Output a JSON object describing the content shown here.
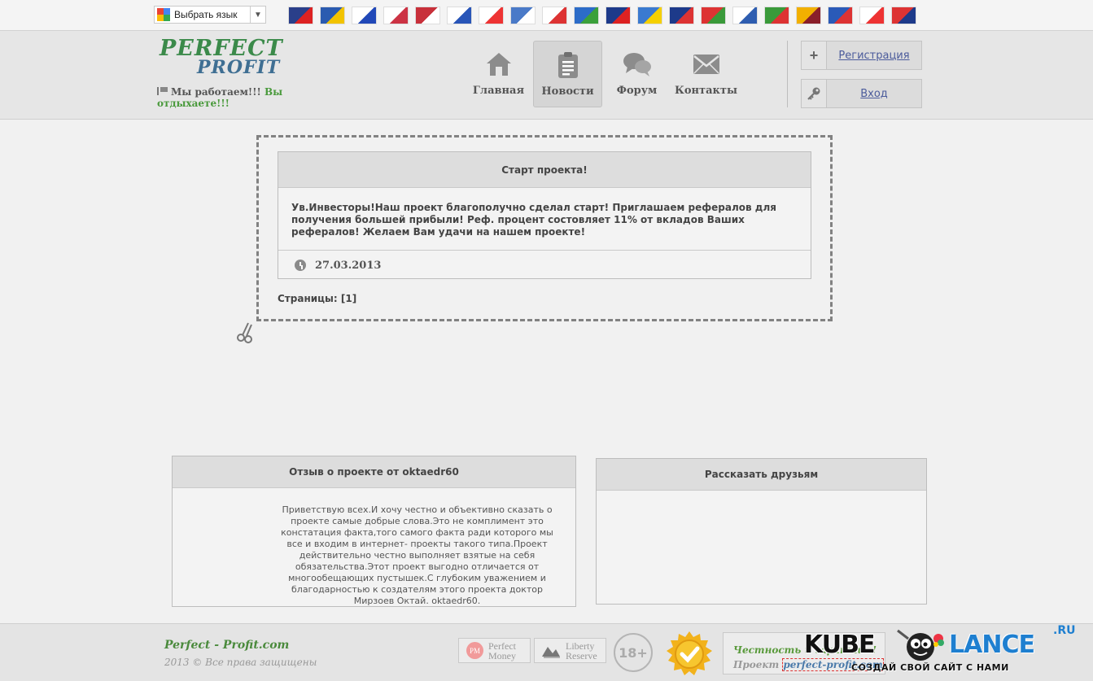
{
  "translate": {
    "label": "Выбрать язык",
    "arrow": "▼"
  },
  "flags": [
    {
      "name": "uk",
      "c1": "#2a3f8a",
      "c2": "#d22"
    },
    {
      "name": "sweden",
      "c1": "#2b5bb0",
      "c2": "#f2c300"
    },
    {
      "name": "russia",
      "c1": "#ffffff",
      "c2": "#2148b8"
    },
    {
      "name": "korea",
      "c1": "#ffffff",
      "c2": "#cc3344"
    },
    {
      "name": "norway",
      "c1": "#c8303a",
      "c2": "#ffffff"
    },
    {
      "name": "israel",
      "c1": "#ffffff",
      "c2": "#2855b8"
    },
    {
      "name": "georgia",
      "c1": "#ffffff",
      "c2": "#e33"
    },
    {
      "name": "greece",
      "c1": "#4a7ac8",
      "c2": "#ffffff"
    },
    {
      "name": "czech",
      "c1": "#ffffff",
      "c2": "#d33"
    },
    {
      "name": "solomon",
      "c1": "#2c6cc8",
      "c2": "#3ba03b"
    },
    {
      "name": "dominican",
      "c1": "#1d3a8a",
      "c2": "#d22"
    },
    {
      "name": "saint-vincent",
      "c1": "#3a7ad0",
      "c2": "#f5d000"
    },
    {
      "name": "costa-rica",
      "c1": "#1d3a8a",
      "c2": "#d33"
    },
    {
      "name": "oman",
      "c1": "#d33",
      "c2": "#3a9a3a"
    },
    {
      "name": "finland",
      "c1": "#ffffff",
      "c2": "#2e5db0"
    },
    {
      "name": "iran",
      "c1": "#3a9a3a",
      "c2": "#d33"
    },
    {
      "name": "sri-lanka",
      "c1": "#f2b000",
      "c2": "#8a1f2a"
    },
    {
      "name": "new-caledonia",
      "c1": "#2a5ab8",
      "c2": "#d33"
    },
    {
      "name": "guernsey",
      "c1": "#ffffff",
      "c2": "#e33"
    },
    {
      "name": "taiwan",
      "c1": "#d33",
      "c2": "#1d3a8a"
    }
  ],
  "header": {
    "logo_line1": "PERFECT",
    "logo_line2": "PROFIT",
    "tagline_a": "Мы работаем!!!",
    "tagline_b": "Вы отдыхаете!!!",
    "nav": [
      {
        "label": "Главная",
        "icon": "home-icon",
        "active": false
      },
      {
        "label": "Новости",
        "icon": "clipboard-icon",
        "active": true
      },
      {
        "label": "Форум",
        "icon": "chat-bubbles-icon",
        "active": false
      },
      {
        "label": "Контакты",
        "icon": "envelope-icon",
        "active": false
      }
    ],
    "register_label": "Регистрация",
    "login_label": "Вход"
  },
  "news": {
    "title": "Старт проекта!",
    "text": "Ув.Инвесторы!Наш проект благополучно сделал старт! Приглашаем рефералов для получения большей прибыли! Реф. процент состовляет 11% от вкладов Ваших рефералов! Желаем Вам удачи на нашем проекте!",
    "date": "27.03.2013",
    "pages": "Страницы: [1]"
  },
  "review": {
    "title": "Отзыв о проекте от oktaedr60",
    "text": "Приветствую всех.И хочу честно и объективно сказать о проекте самые добрые слова.Это не комплимент это констатация факта,того самого факта ради которого мы все и входим в интернет- проекты такого типа.Проект действительно честно выполняет взятые на себя обязательства.Этот проект выгодно отличается от многообещающих пустышек.С глубоким уважением и благодарностью к создателям этого проекта доктор Мирзоев Октай. oktaedr60."
  },
  "share": {
    "title": "Рассказать друзьям"
  },
  "footer": {
    "site": "Perfect - Profit.com",
    "copyright": "2013 © Все права защищены",
    "pm_logo": "PM",
    "pm_line1": "Perfect",
    "pm_line2": "Money",
    "lr_line1": "Liberty",
    "lr_line2": "Reserve",
    "age": "18+",
    "honest_line1": "Честность и гарантия!",
    "honest_prefix": "Проект",
    "honest_link": "perfect-profit.com"
  },
  "watermark": {
    "word1": "KUBE",
    "word2": "LANCE",
    "tld": ".RU",
    "slogan": "СОЗДАЙ СВОЙ САЙТ С НАМИ"
  }
}
